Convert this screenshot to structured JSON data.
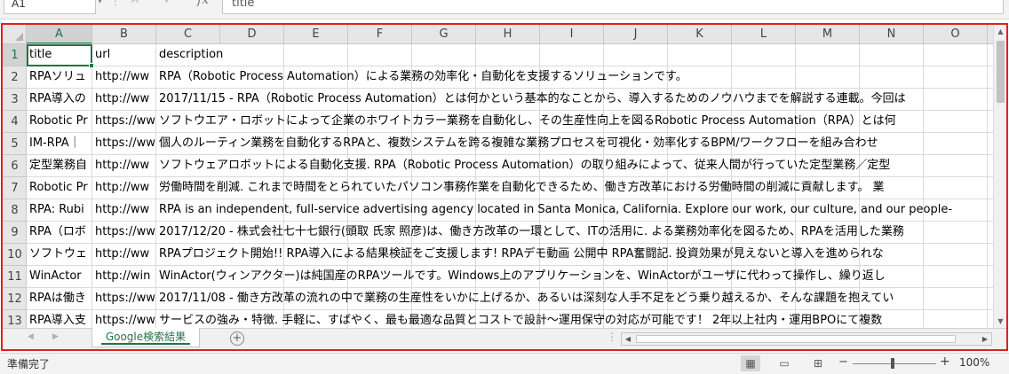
{
  "formula_bar": {
    "name_box": "A1",
    "value": "title"
  },
  "columns": [
    "A",
    "B",
    "C",
    "D",
    "E",
    "F",
    "G",
    "H",
    "I",
    "J",
    "K",
    "L",
    "M",
    "N",
    "O"
  ],
  "rows": [
    {
      "num": "1",
      "a": "title",
      "b": "url",
      "c": "description"
    },
    {
      "num": "2",
      "a": "RPAソリュ",
      "b": "http://ww",
      "c": "RPA（Robotic Process Automation）による業務の効率化・自動化を支援するソリューションです。"
    },
    {
      "num": "3",
      "a": "RPA導入の",
      "b": "http://ww",
      "c": "2017/11/15 - RPA（Robotic Process Automation）とは何かという基本的なことから、導入するためのノウハウまでを解説する連載。今回は"
    },
    {
      "num": "4",
      "a": "Robotic Pr",
      "b": "https://ww",
      "c": "ソフトウエア・ロボットによって企業のホワイトカラー業務を自動化し、その生産性向上を図るRobotic Process Automation（RPA）とは何"
    },
    {
      "num": "5",
      "a": "IM-RPA｜",
      "b": "https://ww",
      "c": "個人のルーティン業務を自動化するRPAと、複数システムを跨る複雑な業務プロセスを可視化・効率化するBPM/ワークフローを組み合わせ"
    },
    {
      "num": "6",
      "a": "定型業務自",
      "b": "http://ww",
      "c": "ソフトウェアロボットによる自動化支援. RPA（Robotic Process Automation）の取り組みによって、従来人間が行っていた定型業務／定型"
    },
    {
      "num": "7",
      "a": "Robotic Pr",
      "b": "http://ww",
      "c": "労働時間を削減. これまで時間をとられていたパソコン事務作業を自動化できるため、働き方改革における労働時間の削減に貢献します。 業"
    },
    {
      "num": "8",
      "a": "RPA: Rubi",
      "b": "http://ww",
      "c": "RPA is an independent, full-service advertising agency located in Santa Monica, California. Explore our work, our culture, and our people-"
    },
    {
      "num": "9",
      "a": "RPA（ロボ",
      "b": "https://ww",
      "c": "2017/12/20 - 株式会社七十七銀行(頭取 氏家 照彦)は、働き方改革の一環として、ITの活用に. よる業務効率化を図るため、RPAを活用した業務"
    },
    {
      "num": "10",
      "a": "ソフトウェ",
      "b": "http://ww",
      "c": "RPAプロジェクト開始!! RPA導入による結果検証をご支援します! RPAデモ動画 公開中 RPA奮闘記. 投資効果が見えないと導入を進められな"
    },
    {
      "num": "11",
      "a": "WinActor",
      "b": "http://win",
      "c": "WinActor(ウィンアクター)は純国産のRPAツールです。Windows上のアプリケーションを、WinActorがユーザに代わって操作し、繰り返し"
    },
    {
      "num": "12",
      "a": "RPAは働き",
      "b": "https://ww",
      "c": "2017/11/08 - 働き方改革の流れの中で業務の生産性をいかに上げるか、あるいは深刻な人手不足をどう乗り越えるか、そんな課題を抱えてい"
    },
    {
      "num": "13",
      "a": "RPA導入支",
      "b": "https://ww",
      "c": "サービスの強み・特徴. 手軽に、すばやく、最も最適な品質とコストで設計～運用保守の対応が可能です！ 2年以上社内・運用BPOにて複数"
    }
  ],
  "sheet_tab": {
    "label": "Google検索結果"
  },
  "status_bar": {
    "status": "準備完了",
    "zoom": "100%"
  },
  "icons": {
    "cancel": "✕",
    "enter": "✓",
    "function": "fx",
    "add_sheet": "+",
    "normal_view": "▦",
    "page_layout_view": "▭",
    "page_break_view": "⊞"
  },
  "colors": {
    "accent": "#217346",
    "highlight_frame": "#e02020"
  }
}
